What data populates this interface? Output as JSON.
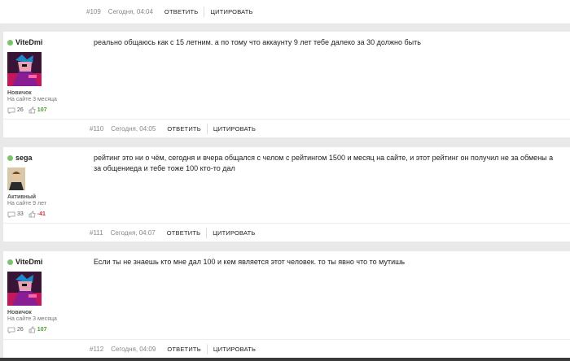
{
  "top_post": {
    "number": "#109",
    "time": "Сегодня, 04:04",
    "reply_label": "ОТВЕТИТЬ",
    "quote_label": "ЦИТИРОВАТЬ"
  },
  "posts": [
    {
      "username": "ViteDmi",
      "online": true,
      "rank": "Новичок",
      "since": "На сайте 3 месяца",
      "comments": "26",
      "rating": "107",
      "message": "реально общаюсь как с 15 летним.   а по тому что аккаунту 9 лет тебе далеко за 30 должно быть",
      "number": "#110",
      "time": "Сегодня, 04:05",
      "reply_label": "ОТВЕТИТЬ",
      "quote_label": "ЦИТИРОВАТЬ"
    },
    {
      "username": "sega",
      "online": true,
      "rank": "Активный",
      "since": "На сайте 9 лет",
      "comments": "33",
      "rating": "-41",
      "message": "рейтинг это ни о чём, сегодня и вчера общался с челом с рейтингом 1500 и месяц на сайте,  и этот рейтинг он получил не за обмены а за общениеда и тебе тоже 100 кто-то дал",
      "number": "#111",
      "time": "Сегодня, 04:07",
      "reply_label": "ОТВЕТИТЬ",
      "quote_label": "ЦИТИРОВАТЬ"
    },
    {
      "username": "ViteDmi",
      "online": true,
      "rank": "Новичок",
      "since": "На сайте 3 месяца",
      "comments": "26",
      "rating": "107",
      "message": "Если ты не знаешь кто мне дал 100 и кем является этот человек. то ты явно что то мутишь",
      "number": "#112",
      "time": "Сегодня, 04:09",
      "reply_label": "ОТВЕТИТЬ",
      "quote_label": "ЦИТИРОВАТЬ"
    }
  ],
  "colors": {
    "online": "#7cc36b",
    "rating_positive": "#4c9b2f",
    "rating_negative": "#c73232",
    "page_background": "#e9e9e9"
  }
}
